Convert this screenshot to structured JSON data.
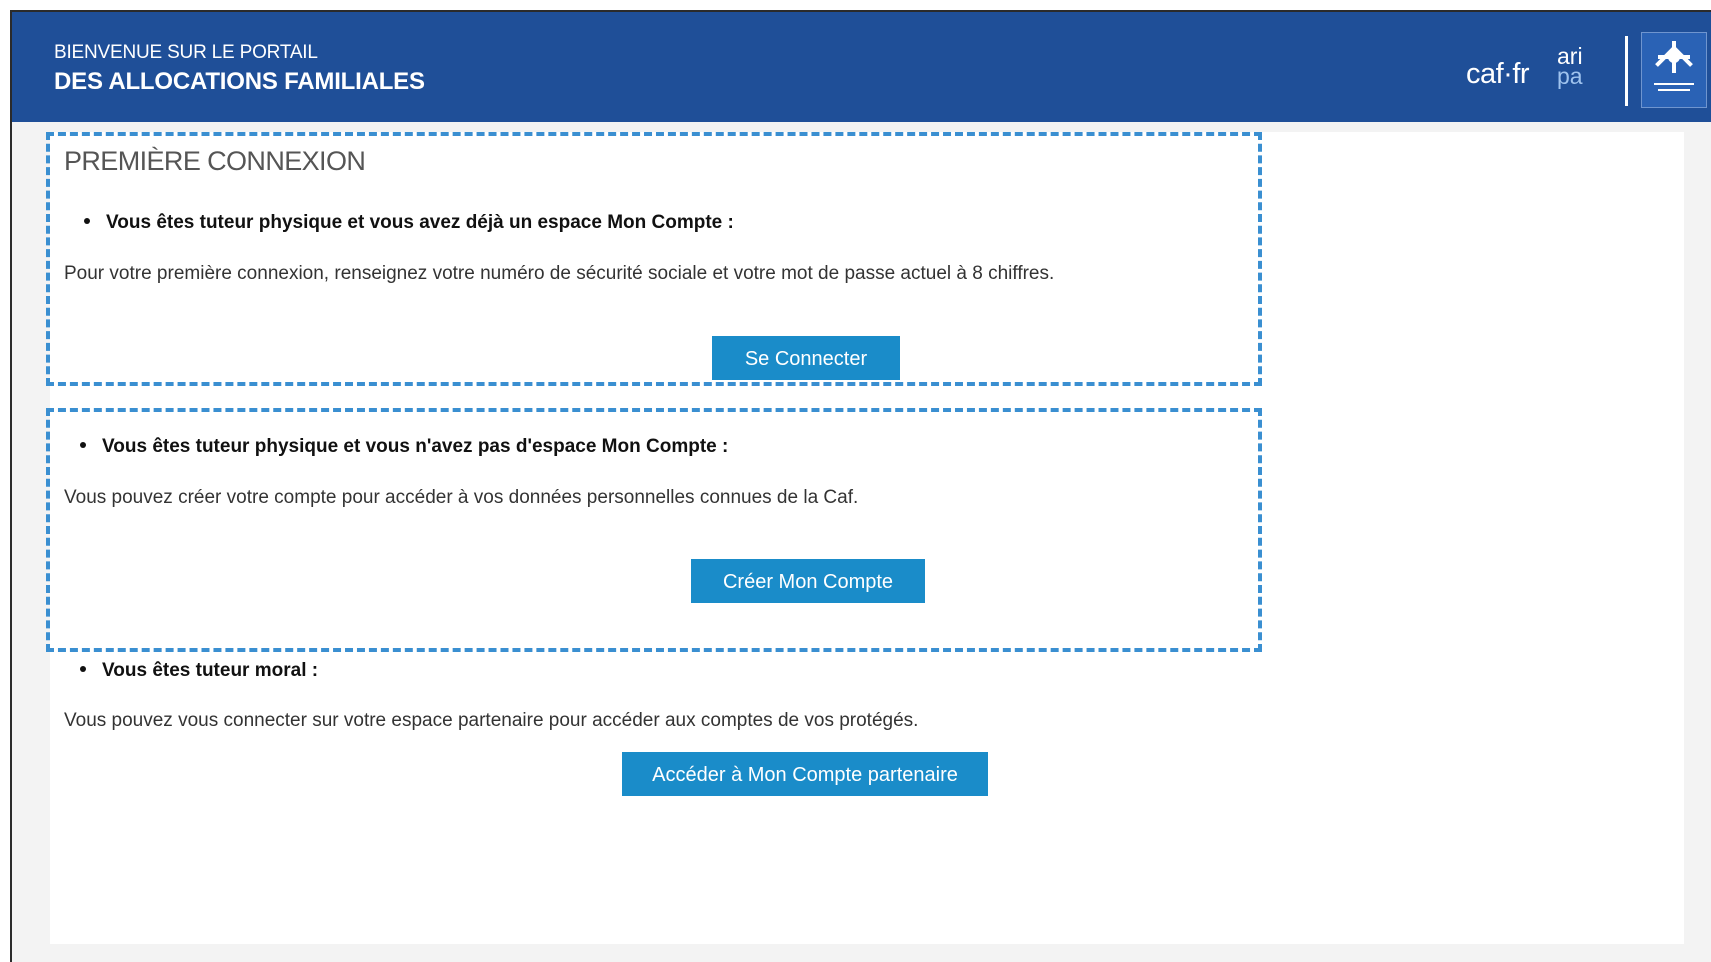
{
  "header": {
    "subtitle": "BIENVENUE SUR LE PORTAIL",
    "title": "DES ALLOCATIONS FAMILIALES",
    "logos": {
      "caf": "caf·fr",
      "aripa_top": "ari",
      "aripa_bottom": "pa",
      "emblem": "allocations-familiales-emblem"
    }
  },
  "section": {
    "title": "PREMIÈRE CONNEXION"
  },
  "blocks": [
    {
      "bullet": "Vous êtes tuteur physique et vous avez déjà un espace Mon Compte :",
      "text": "Pour votre première connexion, renseignez votre numéro de sécurité sociale et votre mot de passe actuel à 8 chiffres.",
      "button": "Se Connecter"
    },
    {
      "bullet": "Vous êtes tuteur physique et vous n'avez pas d'espace Mon Compte :",
      "text": "Vous pouvez créer votre compte pour accéder à vos données personnelles connues de la Caf.",
      "button": "Créer Mon Compte"
    },
    {
      "bullet": "Vous êtes tuteur moral :",
      "text": "Vous pouvez vous connecter sur votre espace partenaire pour accéder aux comptes de vos protégés.",
      "button": "Accéder à Mon Compte partenaire"
    }
  ],
  "colors": {
    "header_bg": "#1f4f98",
    "button_bg": "#1a8cc9",
    "dashed_border": "#3a8fd1"
  }
}
